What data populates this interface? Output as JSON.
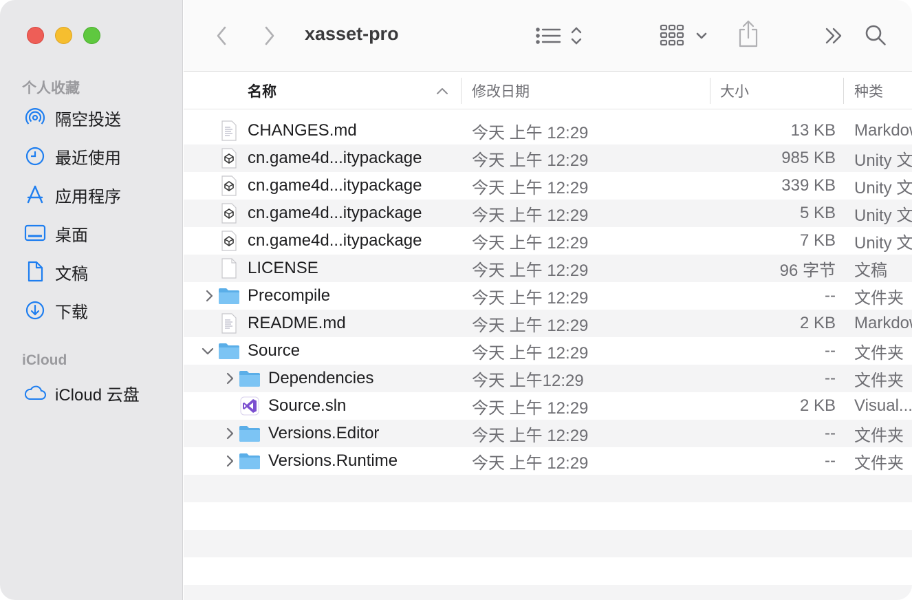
{
  "window": {
    "title": "xasset-pro"
  },
  "sidebar": {
    "favorites_title": "个人收藏",
    "favorites": [
      {
        "label": "隔空投送",
        "icon": "airdrop-icon"
      },
      {
        "label": "最近使用",
        "icon": "clock-icon"
      },
      {
        "label": "应用程序",
        "icon": "applications-icon"
      },
      {
        "label": "桌面",
        "icon": "desktop-icon"
      },
      {
        "label": "文稿",
        "icon": "document-icon"
      },
      {
        "label": "下载",
        "icon": "download-icon"
      }
    ],
    "icloud_title": "iCloud",
    "icloud": [
      {
        "label": "iCloud 云盘",
        "icon": "cloud-icon"
      }
    ]
  },
  "columns": {
    "name": "名称",
    "date": "修改日期",
    "size": "大小",
    "kind": "种类"
  },
  "files": [
    {
      "name": "CHANGES.md",
      "date": "今天 上午 12:29",
      "size": "13 KB",
      "kind": "Markdown",
      "icon": "markdown-file-icon"
    },
    {
      "name": "cn.game4d...itypackage",
      "date": "今天 上午 12:29",
      "size": "985 KB",
      "kind": "Unity 文",
      "icon": "unity-package-icon"
    },
    {
      "name": "cn.game4d...itypackage",
      "date": "今天 上午 12:29",
      "size": "339 KB",
      "kind": "Unity 文",
      "icon": "unity-package-icon"
    },
    {
      "name": "cn.game4d...itypackage",
      "date": "今天 上午 12:29",
      "size": "5 KB",
      "kind": "Unity 文",
      "icon": "unity-package-icon"
    },
    {
      "name": "cn.game4d...itypackage",
      "date": "今天 上午 12:29",
      "size": "7 KB",
      "kind": "Unity 文",
      "icon": "unity-package-icon"
    },
    {
      "name": "LICENSE",
      "date": "今天 上午 12:29",
      "size": "96 字节",
      "kind": "文稿",
      "icon": "blank-file-icon"
    },
    {
      "name": "Precompile",
      "date": "今天 上午 12:29",
      "size": "--",
      "kind": "文件夹",
      "icon": "folder-icon"
    },
    {
      "name": "README.md",
      "date": "今天 上午 12:29",
      "size": "2 KB",
      "kind": "Markdown",
      "icon": "markdown-file-icon"
    },
    {
      "name": "Source",
      "date": "今天 上午 12:29",
      "size": "--",
      "kind": "文件夹",
      "icon": "folder-icon"
    },
    {
      "name": "Dependencies",
      "date": "今天 上午12:29",
      "size": "--",
      "kind": "文件夹",
      "icon": "folder-icon"
    },
    {
      "name": "Source.sln",
      "date": "今天 上午 12:29",
      "size": "2 KB",
      "kind": "Visual...",
      "icon": "visual-studio-icon"
    },
    {
      "name": "Versions.Editor",
      "date": "今天 上午 12:29",
      "size": "--",
      "kind": "文件夹",
      "icon": "folder-icon"
    },
    {
      "name": "Versions.Runtime",
      "date": "今天 上午 12:29",
      "size": "--",
      "kind": "文件夹",
      "icon": "folder-icon"
    }
  ],
  "colors": {
    "sidebar_bg": "#e8e8ea",
    "accent": "#1e7ef0",
    "folder": "#6ab8ee",
    "row_alt": "#f4f4f5"
  }
}
